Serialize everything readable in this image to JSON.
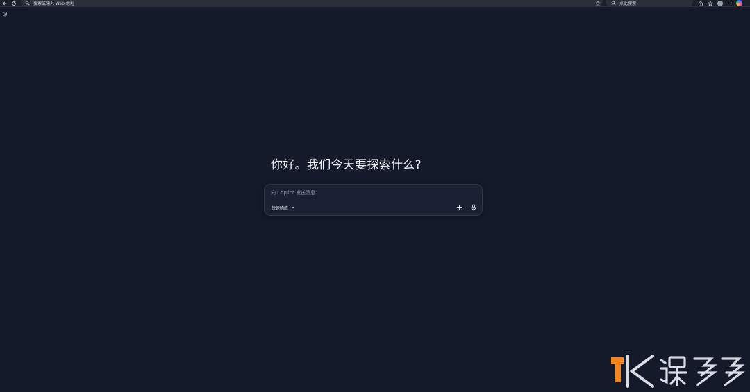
{
  "browser": {
    "address_placeholder": "搜索或输入 Web 地址",
    "search_placeholder": "点此搜索",
    "more_label": "···"
  },
  "page": {
    "greeting": "你好。我们今天要探索什么?"
  },
  "composer": {
    "input_value": "",
    "input_placeholder": "向 Copilot 发送消息",
    "mode_label": "快速响应"
  },
  "colors": {
    "background": "#151a2b",
    "composer_bg": "#1b2133",
    "watermark_orange": "#f5841f"
  },
  "icons": {
    "back": "back-arrow-icon",
    "refresh": "refresh-icon",
    "search": "search-icon",
    "favorite": "star-icon",
    "history": "history-icon",
    "plus": "plus-icon",
    "mic": "microphone-icon",
    "chevron": "chevron-down-icon"
  }
}
